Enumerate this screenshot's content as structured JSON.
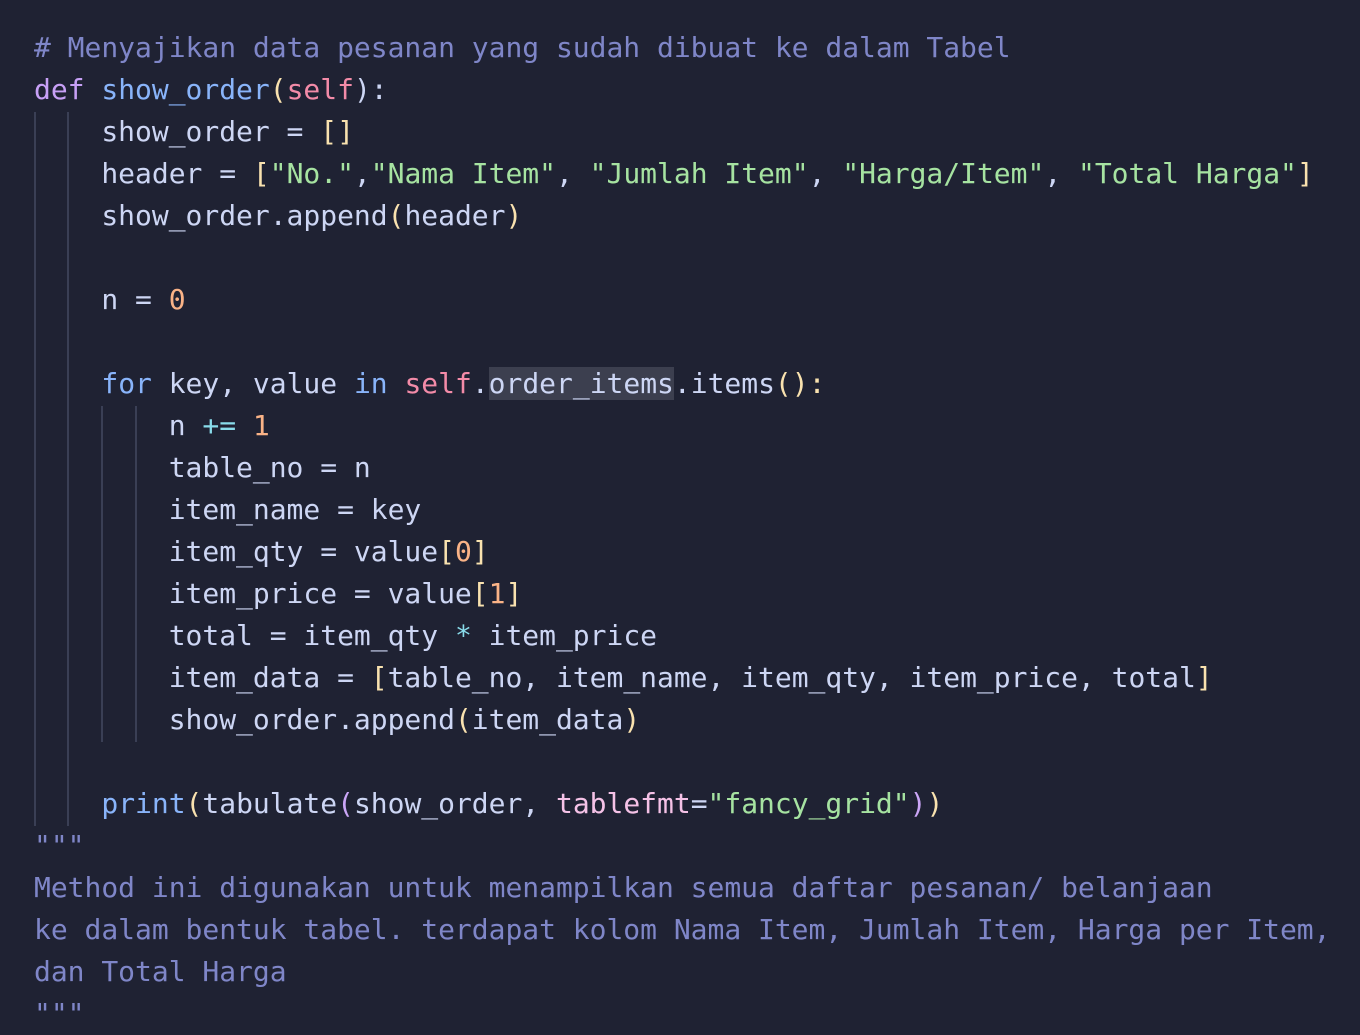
{
  "editor": {
    "theme": {
      "background": "#1f2233",
      "comment": "#7f86c8",
      "keyword": "#c7a0f6",
      "function": "#89b4fa",
      "self": "#f38ba8",
      "string": "#a6e3a1",
      "number": "#fab387"
    },
    "lines": [
      {
        "tokens": [
          {
            "t": "# Menyajikan data pesanan yang sudah dibuat ke dalam Tabel",
            "c": "comment"
          }
        ]
      },
      {
        "tokens": [
          {
            "t": "def",
            "c": "keyword"
          },
          {
            "t": " ",
            "c": "text"
          },
          {
            "t": "show_order",
            "c": "func"
          },
          {
            "t": "(",
            "c": "paren"
          },
          {
            "t": "self",
            "c": "self"
          },
          {
            "t": "):",
            "c": "text"
          }
        ]
      },
      {
        "tokens": [
          {
            "t": "    show_order = ",
            "c": "text"
          },
          {
            "t": "[]",
            "c": "bracket"
          }
        ]
      },
      {
        "tokens": [
          {
            "t": "    header = ",
            "c": "text"
          },
          {
            "t": "[",
            "c": "bracket"
          },
          {
            "t": "\"No.\"",
            "c": "string"
          },
          {
            "t": ",",
            "c": "text"
          },
          {
            "t": "\"Nama Item\"",
            "c": "string"
          },
          {
            "t": ", ",
            "c": "text"
          },
          {
            "t": "\"Jumlah Item\"",
            "c": "string"
          },
          {
            "t": ", ",
            "c": "text"
          },
          {
            "t": "\"Harga/Item\"",
            "c": "string"
          },
          {
            "t": ", ",
            "c": "text"
          },
          {
            "t": "\"Total Harga\"",
            "c": "string"
          },
          {
            "t": "]",
            "c": "bracket"
          }
        ]
      },
      {
        "tokens": [
          {
            "t": "    show_order.append",
            "c": "text"
          },
          {
            "t": "(",
            "c": "paren"
          },
          {
            "t": "header",
            "c": "text"
          },
          {
            "t": ")",
            "c": "paren"
          }
        ]
      },
      {
        "tokens": []
      },
      {
        "tokens": [
          {
            "t": "    n = ",
            "c": "text"
          },
          {
            "t": "0",
            "c": "number"
          }
        ]
      },
      {
        "tokens": []
      },
      {
        "tokens": [
          {
            "t": "    ",
            "c": "text"
          },
          {
            "t": "for",
            "c": "func"
          },
          {
            "t": " key, value ",
            "c": "text"
          },
          {
            "t": "in",
            "c": "func"
          },
          {
            "t": " ",
            "c": "text"
          },
          {
            "t": "self",
            "c": "self"
          },
          {
            "t": ".",
            "c": "text"
          },
          {
            "t": "order_items",
            "c": "hl"
          },
          {
            "t": ".items",
            "c": "text"
          },
          {
            "t": "():",
            "c": "paren"
          }
        ]
      },
      {
        "tokens": [
          {
            "t": "        n ",
            "c": "text"
          },
          {
            "t": "+=",
            "c": "op"
          },
          {
            "t": " ",
            "c": "text"
          },
          {
            "t": "1",
            "c": "number"
          }
        ]
      },
      {
        "tokens": [
          {
            "t": "        table_no = n",
            "c": "text"
          }
        ]
      },
      {
        "tokens": [
          {
            "t": "        item_name = key",
            "c": "text"
          }
        ]
      },
      {
        "tokens": [
          {
            "t": "        item_qty = value",
            "c": "text"
          },
          {
            "t": "[",
            "c": "bracket"
          },
          {
            "t": "0",
            "c": "number"
          },
          {
            "t": "]",
            "c": "bracket"
          }
        ]
      },
      {
        "tokens": [
          {
            "t": "        item_price = value",
            "c": "text"
          },
          {
            "t": "[",
            "c": "bracket"
          },
          {
            "t": "1",
            "c": "number"
          },
          {
            "t": "]",
            "c": "bracket"
          }
        ]
      },
      {
        "tokens": [
          {
            "t": "        total = item_qty ",
            "c": "text"
          },
          {
            "t": "*",
            "c": "op"
          },
          {
            "t": " item_price",
            "c": "text"
          }
        ]
      },
      {
        "tokens": [
          {
            "t": "        item_data = ",
            "c": "text"
          },
          {
            "t": "[",
            "c": "bracket"
          },
          {
            "t": "table_no, item_name, item_qty, item_price, total",
            "c": "text"
          },
          {
            "t": "]",
            "c": "bracket"
          }
        ]
      },
      {
        "tokens": [
          {
            "t": "        show_order.append",
            "c": "text"
          },
          {
            "t": "(",
            "c": "paren"
          },
          {
            "t": "item_data",
            "c": "text"
          },
          {
            "t": ")",
            "c": "paren"
          }
        ]
      },
      {
        "tokens": []
      },
      {
        "tokens": [
          {
            "t": "    ",
            "c": "text"
          },
          {
            "t": "print",
            "c": "func"
          },
          {
            "t": "(",
            "c": "paren"
          },
          {
            "t": "tabulate",
            "c": "text"
          },
          {
            "t": "(",
            "c": "bracket2"
          },
          {
            "t": "show_order, ",
            "c": "text"
          },
          {
            "t": "tablefmt",
            "c": "param"
          },
          {
            "t": "=",
            "c": "text"
          },
          {
            "t": "\"fancy_grid\"",
            "c": "string"
          },
          {
            "t": ")",
            "c": "bracket2"
          },
          {
            "t": ")",
            "c": "paren"
          }
        ]
      },
      {
        "tokens": [
          {
            "t": "\"\"\"",
            "c": "comment"
          }
        ]
      },
      {
        "tokens": [
          {
            "t": "Method ini digunakan untuk menampilkan semua daftar pesanan/ belanjaan",
            "c": "comment"
          }
        ]
      },
      {
        "tokens": [
          {
            "t": "ke dalam bentuk tabel. terdapat kolom Nama Item, Jumlah Item, Harga per Item,",
            "c": "comment"
          }
        ]
      },
      {
        "tokens": [
          {
            "t": "dan Total Harga",
            "c": "comment"
          }
        ]
      },
      {
        "tokens": [
          {
            "t": "\"\"\"",
            "c": "comment"
          }
        ]
      }
    ]
  }
}
